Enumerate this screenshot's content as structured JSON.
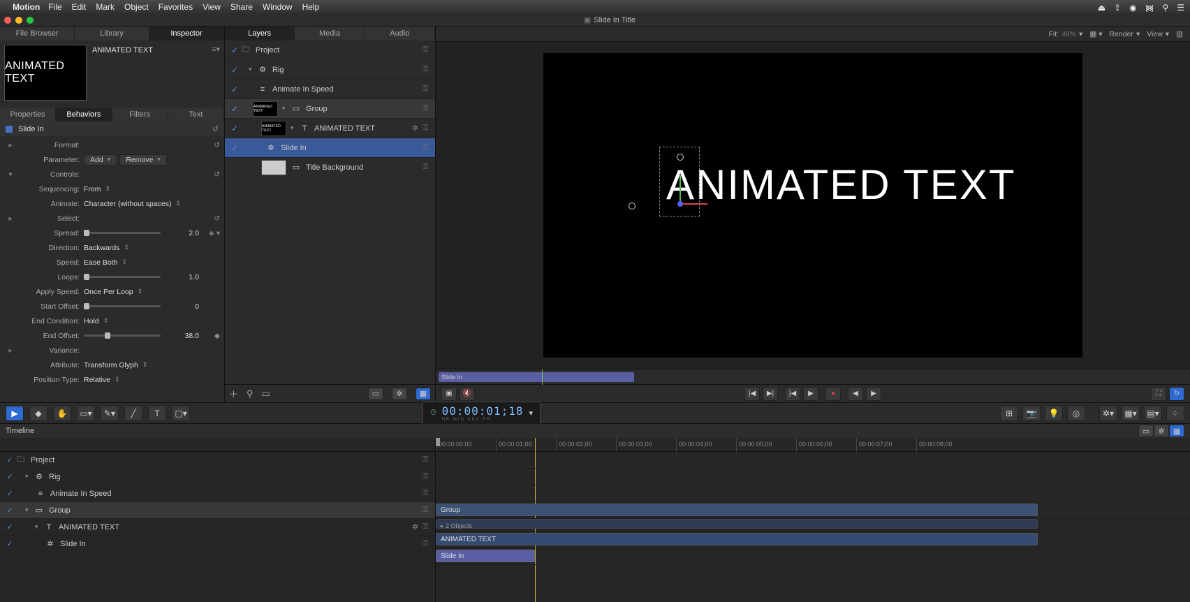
{
  "menubar": {
    "app": "Motion",
    "items": [
      "File",
      "Edit",
      "Mark",
      "Object",
      "Favorites",
      "View",
      "Share",
      "Window",
      "Help"
    ]
  },
  "window": {
    "title": "Slide In Title"
  },
  "left": {
    "topTabs": [
      "File Browser",
      "Library",
      "Inspector"
    ],
    "activeTopTab": 2,
    "objectTitle": "ANIMATED TEXT",
    "thumbText": "ANIMATED TEXT",
    "inspTabs": [
      "Properties",
      "Behaviors",
      "Filters",
      "Text"
    ],
    "activeInspTab": 1,
    "behavior": {
      "name": "Slide In",
      "formatLabel": "Format:",
      "parameterLabel": "Parameter:",
      "addBtn": "Add",
      "removeBtn": "Remove",
      "controlsLabel": "Controls:",
      "rows": {
        "sequencing": {
          "label": "Sequencing:",
          "value": "From"
        },
        "animate": {
          "label": "Animate:",
          "value": "Character (without spaces)"
        },
        "select": {
          "label": "Select:"
        },
        "spread": {
          "label": "Spread:",
          "value": "2.0"
        },
        "direction": {
          "label": "Direction:",
          "value": "Backwards"
        },
        "speed": {
          "label": "Speed:",
          "value": "Ease Both"
        },
        "loops": {
          "label": "Loops:",
          "value": "1.0"
        },
        "applySpeed": {
          "label": "Apply Speed:",
          "value": "Once Per Loop"
        },
        "startOffset": {
          "label": "Start Offset:",
          "value": "0"
        },
        "endCondition": {
          "label": "End Condition:",
          "value": "Hold"
        },
        "endOffset": {
          "label": "End Offset:",
          "value": "38.0"
        },
        "variance": {
          "label": "Variance:"
        },
        "attribute": {
          "label": "Attribute:",
          "value": "Transform Glyph"
        },
        "positionType": {
          "label": "Position Type:",
          "value": "Relative"
        }
      }
    }
  },
  "layers": {
    "tabs": [
      "Layers",
      "Media",
      "Audio"
    ],
    "activeTab": 0,
    "items": [
      {
        "name": "Project",
        "kind": "project",
        "checked": true,
        "indent": 0
      },
      {
        "name": "Rig",
        "kind": "rig",
        "checked": true,
        "indent": 1,
        "thumb": false,
        "disc": true
      },
      {
        "name": "Animate In Speed",
        "kind": "param",
        "checked": true,
        "indent": 2
      },
      {
        "name": "Group",
        "kind": "group",
        "checked": true,
        "indent": 1,
        "thumb": true,
        "disc": true,
        "open": true
      },
      {
        "name": "ANIMATED TEXT",
        "kind": "text",
        "checked": true,
        "indent": 2,
        "thumb": true,
        "disc": true,
        "gear": true
      },
      {
        "name": "Slide In",
        "kind": "behavior",
        "checked": true,
        "indent": 3,
        "selected": true
      },
      {
        "name": "Title Background",
        "kind": "layer",
        "checked": false,
        "indent": 2,
        "thumb": true,
        "greythumb": true
      }
    ]
  },
  "canvas": {
    "fitLabel": "Fit:",
    "fitValue": "49%",
    "renderLabel": "Render",
    "viewLabel": "View",
    "text": "ANIMATED TEXT",
    "miniBarLabel": "Slide In",
    "timecode": "00:00:01;18",
    "tcLabels": "HR  MIN  SEC  FR"
  },
  "timeline": {
    "header": "Timeline",
    "ticks": [
      "00:00:00;00",
      "00:00:01;00",
      "00:00:02;00",
      "00:00:03;00",
      "00:00:04;00",
      "00:00:05;00",
      "00:00:06;00",
      "00:00:07;00",
      "00:00:08;00"
    ],
    "rows": [
      {
        "name": "Project",
        "kind": "project",
        "checked": true,
        "indent": 0
      },
      {
        "name": "Rig",
        "kind": "rig",
        "checked": true,
        "indent": 1,
        "disc": true
      },
      {
        "name": "Animate In Speed",
        "kind": "param",
        "checked": true,
        "indent": 2
      },
      {
        "name": "Group",
        "kind": "group",
        "checked": true,
        "indent": 1,
        "disc": true,
        "open": true
      },
      {
        "name": "ANIMATED TEXT",
        "kind": "text",
        "checked": true,
        "indent": 2,
        "disc": true,
        "gear": true
      },
      {
        "name": "Slide In",
        "kind": "behavior",
        "checked": true,
        "indent": 3
      }
    ],
    "clips": {
      "group": "Group",
      "objects": "▸ 2 Objects",
      "text": "ANIMATED TEXT",
      "slidein": "Slide In"
    }
  }
}
